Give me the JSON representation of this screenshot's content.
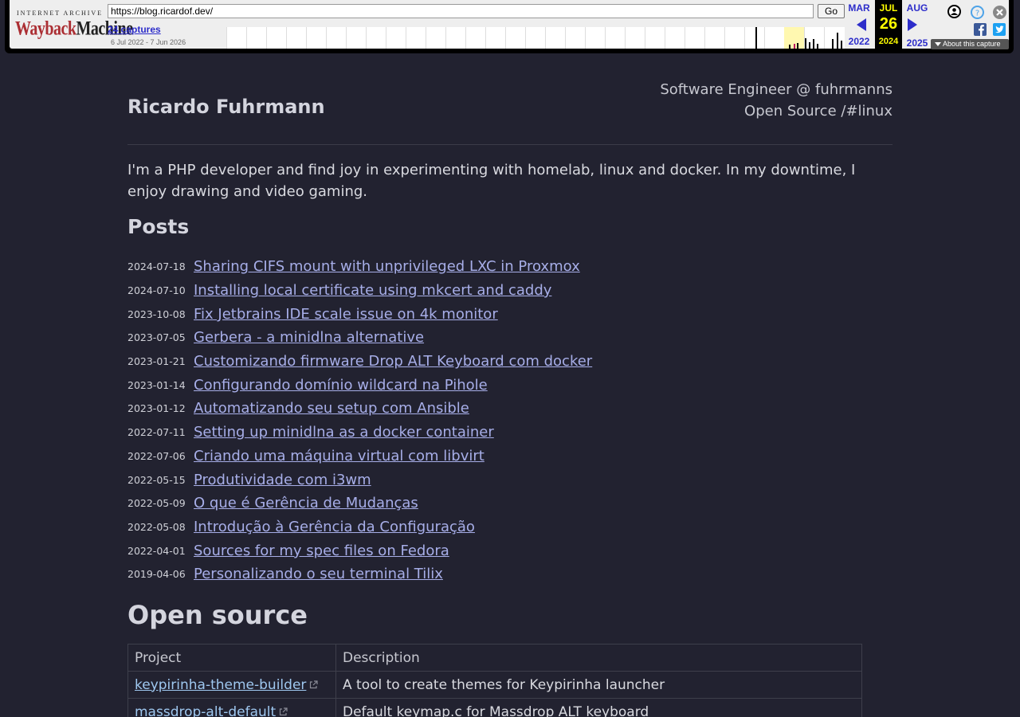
{
  "wayback": {
    "logo_top": "INTERNET ARCHIVE",
    "logo_wayback": "Wayback",
    "logo_machine": "Machine",
    "url": "https://blog.ricardof.dev/",
    "go_label": "Go",
    "captures": "24 captures",
    "range": "6 Jul 2022 - 7 Jun 2026",
    "prev_month": "MAR",
    "prev_year": "2022",
    "cur_month": "JUL",
    "cur_day": "26",
    "cur_year": "2024",
    "next_month": "AUG",
    "next_year": "2025",
    "about": "About this capture",
    "colors": {
      "link": "#2d2dca",
      "current": "#ffff00"
    }
  },
  "header": {
    "title": "Ricardo Fuhrmann",
    "tagline_1": "Software Engineer @ fuhrmanns",
    "tagline_2": "Open Source /#linux"
  },
  "intro": "I'm a PHP developer and find joy in experimenting with homelab, linux and docker. In my downtime, I enjoy drawing and video gaming.",
  "posts": {
    "heading": "Posts",
    "items": [
      {
        "date": "2024-07-18",
        "title": "Sharing CIFS mount with unprivileged LXC in Proxmox"
      },
      {
        "date": "2024-07-10",
        "title": "Installing local certificate using mkcert and caddy"
      },
      {
        "date": "2023-10-08",
        "title": "Fix Jetbrains IDE scale issue on 4k monitor"
      },
      {
        "date": "2023-07-05",
        "title": "Gerbera - a minidlna alternative"
      },
      {
        "date": "2023-01-21",
        "title": "Customizando firmware Drop ALT Keyboard com docker"
      },
      {
        "date": "2023-01-14",
        "title": "Configurando domínio wildcard na Pihole"
      },
      {
        "date": "2023-01-12",
        "title": "Automatizando seu setup com Ansible"
      },
      {
        "date": "2022-07-11",
        "title": "Setting up minidlna as a docker container"
      },
      {
        "date": "2022-07-06",
        "title": "Criando uma máquina virtual com libvirt"
      },
      {
        "date": "2022-05-15",
        "title": "Produtividade com i3wm"
      },
      {
        "date": "2022-05-09",
        "title": "O que é Gerência de Mudanças"
      },
      {
        "date": "2022-05-08",
        "title": "Introdução à Gerência da Configuração"
      },
      {
        "date": "2022-04-01",
        "title": "Sources for my spec files on Fedora"
      },
      {
        "date": "2019-04-06",
        "title": "Personalizando o seu terminal Tilix"
      }
    ]
  },
  "open_source": {
    "heading": "Open source",
    "col_project": "Project",
    "col_description": "Description",
    "rows": [
      {
        "project": "keypirinha-theme-builder",
        "description": "A tool to create themes for Keypirinha launcher"
      },
      {
        "project": "massdrop-alt-default",
        "description": "Default keymap.c for Massdrop ALT keyboard"
      }
    ]
  },
  "colors": {
    "background": "#222230",
    "link": "#a7aee8",
    "table_link": "#9fc8f0"
  }
}
